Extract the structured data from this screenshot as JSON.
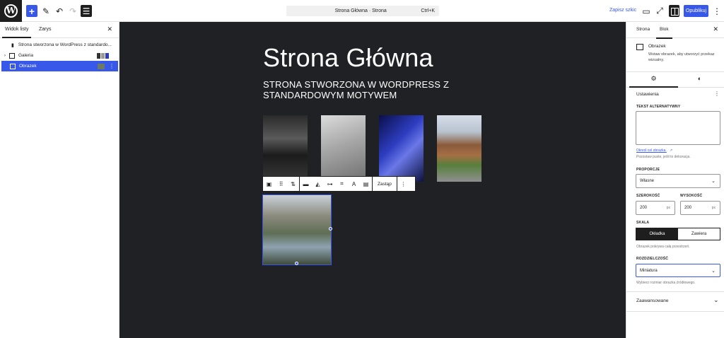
{
  "command_bar": {
    "title": "Strona Główna · Strona",
    "shortcut": "Ctrl+K"
  },
  "header": {
    "save_draft": "Zapisz szkic",
    "publish": "Opublikuj"
  },
  "left_panel": {
    "tabs": [
      "Widok listy",
      "Zarys"
    ],
    "items": [
      {
        "label": "Strona stworzona w WordPress z standardo..."
      },
      {
        "label": "Galeria"
      },
      {
        "label": "Obrazek"
      }
    ]
  },
  "canvas": {
    "title": "Strona Główna",
    "subtitle": "STRONA STWORZONA W WORDPRESS Z STANDARDOWYM MOTYWEM",
    "toolbar_replace": "Zastąp"
  },
  "right_panel": {
    "tabs": [
      "Strona",
      "Blok"
    ],
    "block_name": "Obrazek",
    "block_desc": "Wstaw obrazek, aby utworzyć przekaz wizualny.",
    "settings_title": "Ustawienia",
    "alt_label": "TEKST ALTERNATYWNY",
    "alt_link": "Określ cel obrazka.",
    "alt_help": "Pozostaw puste, jeśli to dekoracja.",
    "aspect_label": "PROPORCJE",
    "aspect_value": "Własne",
    "width_label": "SZEROKOŚĆ",
    "height_label": "WYSOKOŚĆ",
    "width_value": "200",
    "height_value": "200",
    "unit": "px",
    "scale_label": "SKALA",
    "scale_options": [
      "Okładka",
      "Zawiera"
    ],
    "scale_help": "Obrazek pokrywa całą przestrzeń.",
    "resolution_label": "ROZDZIELCZOŚĆ",
    "resolution_value": "Miniatura",
    "resolution_help": "Wybierz rozmiar obrazka źródłowego.",
    "advanced": "Zaawansowane"
  }
}
